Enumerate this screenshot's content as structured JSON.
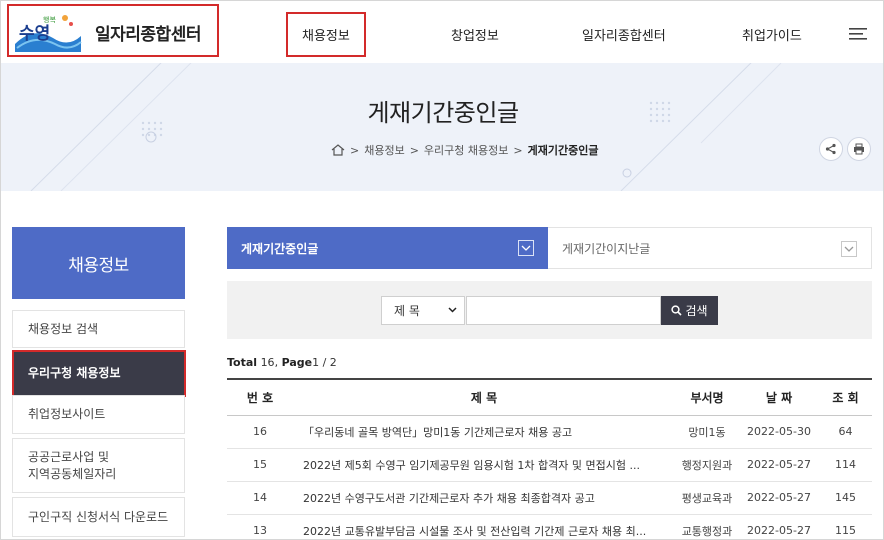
{
  "header": {
    "logo_text": "일자리종합센터",
    "nav": [
      "채용정보",
      "창업정보",
      "일자리종합센터",
      "취업가이드"
    ],
    "menu_icon": "hamburger-menu-icon"
  },
  "banner": {
    "title": "게재기간중인글",
    "breadcrumb": [
      "채용정보",
      "우리구청 채용정보",
      "게재기간중인글"
    ],
    "icons": [
      "home-icon",
      "share-icon",
      "print-icon"
    ]
  },
  "sidebar": {
    "title": "채용정보",
    "items": [
      {
        "label": "채용정보 검색",
        "active": false
      },
      {
        "label": "우리구청 채용정보",
        "active": true
      },
      {
        "label": "취업정보사이트",
        "active": false
      },
      {
        "label": "공공근로사업 및 지역공동체일자리",
        "line1": "공공근로사업 및",
        "line2": "지역공동체일자리",
        "active": false
      },
      {
        "label": "구인구직 신청서식 다운로드",
        "active": false
      }
    ]
  },
  "tabs": [
    {
      "label": "게재기간중인글",
      "active": true
    },
    {
      "label": "게재기간이지난글",
      "active": false
    }
  ],
  "search": {
    "select_value": "제 목",
    "input_value": "",
    "button_label": "검색"
  },
  "total": {
    "label": "Total",
    "count": "16",
    "page_label": "Page",
    "page": "1",
    "pages": "2"
  },
  "table": {
    "headers": [
      "번 호",
      "제 목",
      "부서명",
      "날 짜",
      "조 회"
    ],
    "rows": [
      {
        "no": "16",
        "title": "「우리동네 골목 방역단」망미1동 기간제근로자 채용 공고",
        "dept": "망미1동",
        "date": "2022-05-30",
        "views": "64"
      },
      {
        "no": "15",
        "title": "2022년 제5회 수영구 임기제공무원 임용시험 1차 합격자 및 면접시험 ...",
        "dept": "행정지원과",
        "date": "2022-05-27",
        "views": "114"
      },
      {
        "no": "14",
        "title": "2022년 수영구도서관 기간제근로자 추가 채용 최종합격자 공고",
        "dept": "평생교육과",
        "date": "2022-05-27",
        "views": "145"
      },
      {
        "no": "13",
        "title": "2022년 교통유발부담금 시설물 조사 및 전산입력 기간제 근로자 채용 최...",
        "dept": "교통행정과",
        "date": "2022-05-27",
        "views": "115"
      }
    ]
  },
  "colors": {
    "accent": "#4e6bc6",
    "dark": "#3a3b48",
    "highlight": "#d32a2a",
    "banner_bg": "#eef2f9"
  }
}
